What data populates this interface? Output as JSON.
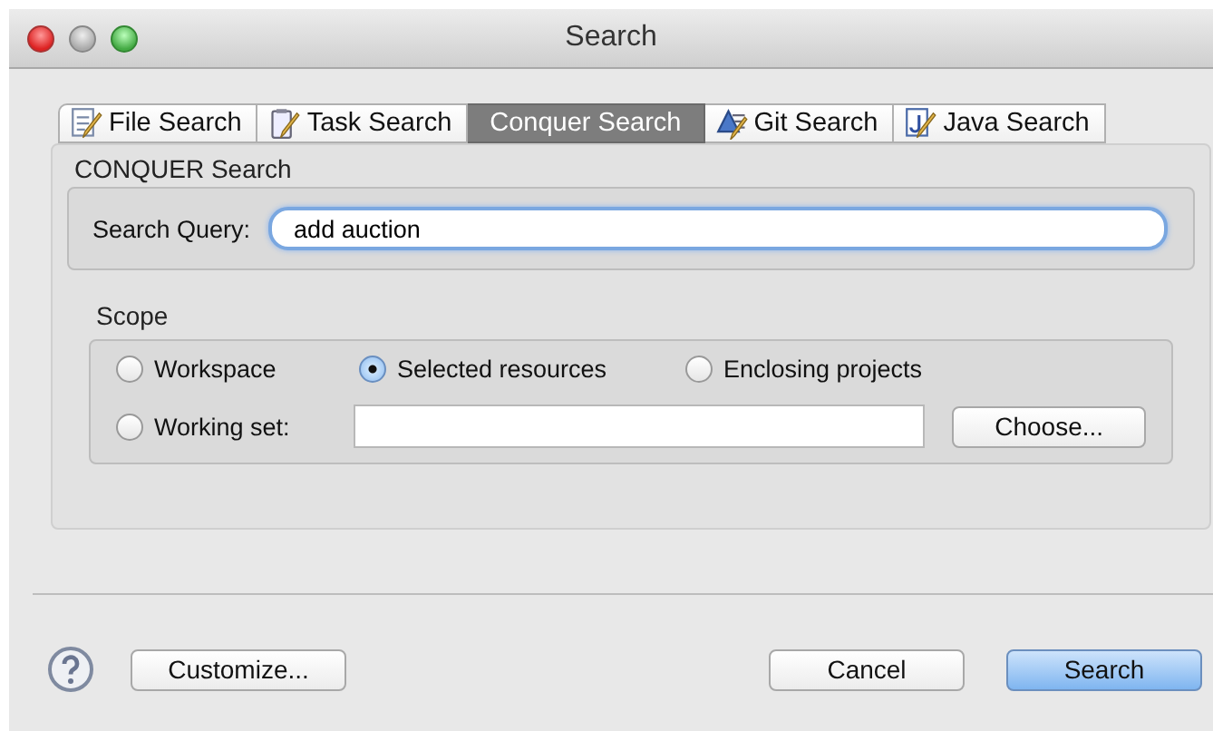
{
  "window": {
    "title": "Search"
  },
  "tabs": [
    {
      "label": "File Search",
      "selected": false,
      "kind": "file"
    },
    {
      "label": "Task Search",
      "selected": false,
      "kind": "task"
    },
    {
      "label": "Conquer Search",
      "selected": true,
      "kind": "plain"
    },
    {
      "label": "Git Search",
      "selected": false,
      "kind": "git"
    },
    {
      "label": "Java Search",
      "selected": false,
      "kind": "java"
    }
  ],
  "conquer": {
    "heading": "CONQUER Search",
    "query_label": "Search Query:",
    "query_value": "add auction"
  },
  "scope": {
    "heading": "Scope",
    "options": [
      {
        "label": "Workspace",
        "selected": false
      },
      {
        "label": "Selected resources",
        "selected": true
      },
      {
        "label": "Enclosing projects",
        "selected": false
      },
      {
        "label": "Working set:",
        "selected": false
      }
    ],
    "choose_button": "Choose..."
  },
  "footer": {
    "customize_button": "Customize...",
    "buttons": [
      {
        "label": "Cancel",
        "default": false
      },
      {
        "label": "Search",
        "default": true
      }
    ]
  }
}
